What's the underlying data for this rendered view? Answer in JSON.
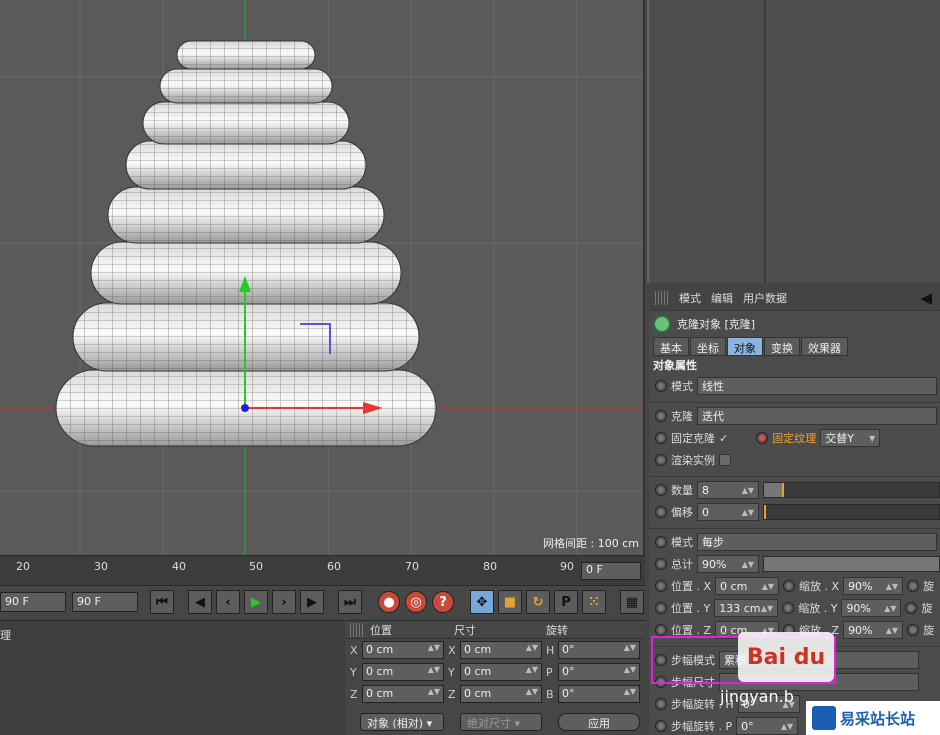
{
  "viewport": {
    "grid_label": "网格间距 : 100 cm"
  },
  "attr": {
    "menu": [
      "模式",
      "编辑",
      "用户数据"
    ],
    "object_title": "克隆对象 [克隆]",
    "tabs": [
      "基本",
      "坐标",
      "对象",
      "变换",
      "效果器"
    ],
    "active_tab": "对象",
    "section_title": "对象属性",
    "mode_label": "模式",
    "mode_value": "线性",
    "clone_label": "克隆",
    "clone_value": "迭代",
    "fixed_clone_label": "固定克隆",
    "fixed_clone_check": "✓",
    "fixed_texture_label": "固定纹理",
    "fixed_texture_value": "交替Y",
    "render_instance_label": "渲染实例",
    "count_label": "数量",
    "count_value": "8",
    "offset_label": "偏移",
    "offset_value": "0",
    "mode2_label": "模式",
    "mode2_value": "每步",
    "total_label": "总计",
    "total_value": "90%",
    "pos_x_label": "位置 . X",
    "pos_x_value": "0 cm",
    "pos_y_label": "位置 . Y",
    "pos_y_value": "133 cm",
    "pos_z_label": "位置 . Z",
    "pos_z_value": "0 cm",
    "scale_x_label": "缩放 . X",
    "scale_x_value": "90%",
    "scale_y_label": "缩放 . Y",
    "scale_y_value": "90%",
    "scale_z_label": "缩放 . Z",
    "scale_z_value": "90%",
    "rot_cut": "旋",
    "step_mode_label": "步幅模式",
    "step_mode_value": "累积",
    "step_size_label": "步幅尺寸",
    "step_rot_h_label": "步幅旋转 . H",
    "step_rot_h_value": "0°",
    "step_rot_p_label": "步幅旋转 . P",
    "step_rot_p_value": "0°"
  },
  "timeline": {
    "ticks": [
      "20",
      "30",
      "40",
      "50",
      "60",
      "70",
      "80",
      "90"
    ],
    "frame_value": "0 F"
  },
  "transport": {
    "field1": "90 F",
    "field2": "90 F"
  },
  "bottom_left": {
    "label": "理"
  },
  "coords": {
    "header_pos": "位置",
    "header_size": "尺寸",
    "header_rot": "旋转",
    "rows": [
      {
        "a1": "X",
        "v1": "0 cm",
        "a2": "X",
        "v2": "0 cm",
        "a3": "H",
        "v3": "0°"
      },
      {
        "a1": "Y",
        "v1": "0 cm",
        "a2": "Y",
        "v2": "0 cm",
        "a3": "P",
        "v3": "0°"
      },
      {
        "a1": "Z",
        "v1": "0 cm",
        "a2": "Z",
        "v2": "0 cm",
        "a3": "B",
        "v3": "0°"
      }
    ],
    "object_mode": "对象 (相对)",
    "abs_size": "绝对尺寸",
    "apply": "应用"
  },
  "watermark": {
    "text": "易采站长站",
    "baidu": "Bai du",
    "jingyan": "jingyan.b"
  }
}
